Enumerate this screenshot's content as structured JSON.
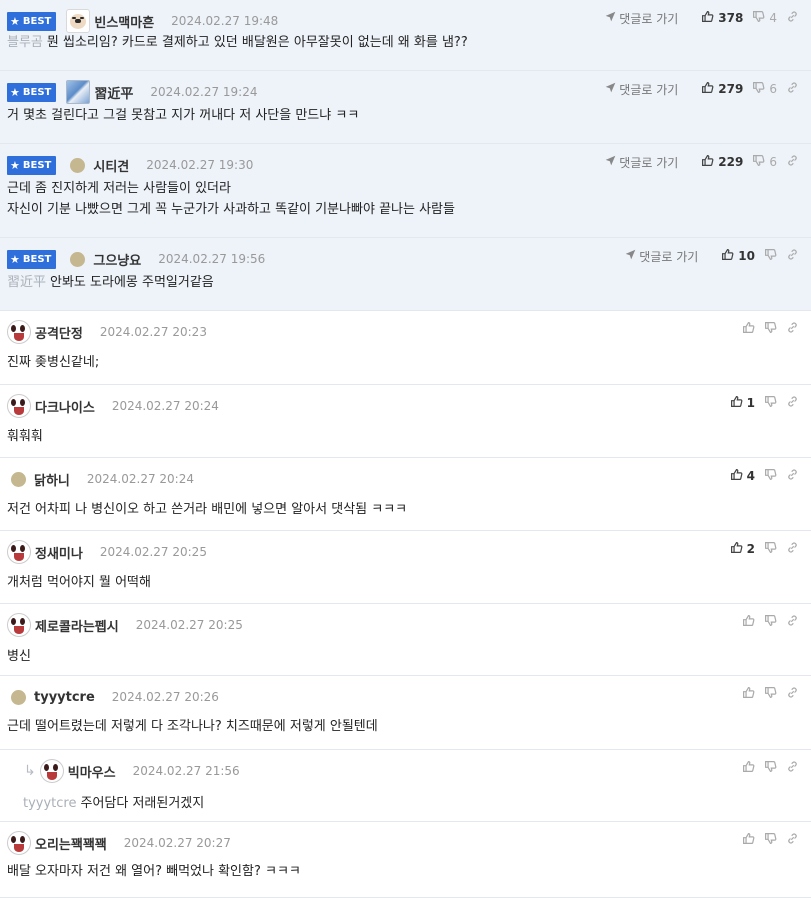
{
  "best_label": "BEST",
  "goto_label": "댓글로 가기",
  "comments": [
    {
      "best": true,
      "avatar": "dog-avatar",
      "author": "빈스맥마흔",
      "date": "2024.02.27 19:48",
      "mention": "블루곰",
      "text": [
        "뭔 씹소리임? 카드로 결제하고 있던 배달원은 아무잘못이 없는데 왜 화를 냄??"
      ],
      "up": "378",
      "down": "4"
    },
    {
      "best": true,
      "avatar": "photo-avatar",
      "author": "習近平",
      "date": "2024.02.27 19:24",
      "mention": "",
      "text": [
        "거 몇초 걸린다고 그걸 못참고 지가 꺼내다 저 사단을 만드냐 ㅋㅋ"
      ],
      "up": "279",
      "down": "6"
    },
    {
      "best": true,
      "avatar": "dot-avatar",
      "author": "시티견",
      "date": "2024.02.27 19:30",
      "mention": "",
      "text": [
        "근데 좀 진지하게 저러는 사람들이 있더라",
        "자신이 기분 나빴으면 그게 꼭 누군가가 사과하고 똑같이 기분나빠야 끝나는 사람들"
      ],
      "up": "229",
      "down": "6"
    },
    {
      "best": true,
      "avatar": "dot-avatar",
      "author": "그으냥요",
      "date": "2024.02.27 19:56",
      "mention": "習近平",
      "text": [
        "안봐도 도라에몽 주먹일거같음"
      ],
      "up": "10",
      "down": ""
    },
    {
      "best": false,
      "avatar": "panda-avatar",
      "author": "공격단정",
      "date": "2024.02.27 20:23",
      "mention": "",
      "text": [
        "진짜 좆병신같네;"
      ],
      "up": "",
      "down": ""
    },
    {
      "best": false,
      "avatar": "panda-avatar",
      "author": "다크나이스",
      "date": "2024.02.27 20:24",
      "mention": "",
      "text": [
        "훠훠훠"
      ],
      "up": "1",
      "down": ""
    },
    {
      "best": false,
      "avatar": "dot-avatar",
      "author": "닭하니",
      "date": "2024.02.27 20:24",
      "mention": "",
      "text": [
        "저건 어차피 나 병신이오 하고 쓴거라 배민에 넣으면 알아서 댓삭됨 ㅋㅋㅋ"
      ],
      "up": "4",
      "down": ""
    },
    {
      "best": false,
      "avatar": "panda-avatar",
      "author": "정새미나",
      "date": "2024.02.27 20:25",
      "mention": "",
      "text": [
        "개처럼 먹어야지 뭘 어떡해"
      ],
      "up": "2",
      "down": ""
    },
    {
      "best": false,
      "avatar": "panda-avatar",
      "author": "제로콜라는펩시",
      "date": "2024.02.27 20:25",
      "mention": "",
      "text": [
        "병신"
      ],
      "up": "",
      "down": ""
    },
    {
      "best": false,
      "avatar": "dot-avatar",
      "author": "tyyytcre",
      "date": "2024.02.27 20:26",
      "mention": "",
      "text": [
        "근데 떨어트렸는데 저렇게 다 조각나나? 치즈때문에 저렇게 안될텐데"
      ],
      "up": "",
      "down": ""
    },
    {
      "best": false,
      "reply": true,
      "avatar": "panda-avatar",
      "author": "빅마우스",
      "date": "2024.02.27 21:56",
      "mention": "tyyytcre",
      "text": [
        "주어담다 저래된거겠지"
      ],
      "up": "",
      "down": ""
    },
    {
      "best": false,
      "avatar": "panda-avatar",
      "author": "오리는꽥꽥꽥",
      "date": "2024.02.27 20:27",
      "mention": "",
      "text": [
        "배달 오자마자 저건 왜 열어? 빼먹었나 확인함? ㅋㅋㅋ"
      ],
      "up": "",
      "down": ""
    }
  ]
}
